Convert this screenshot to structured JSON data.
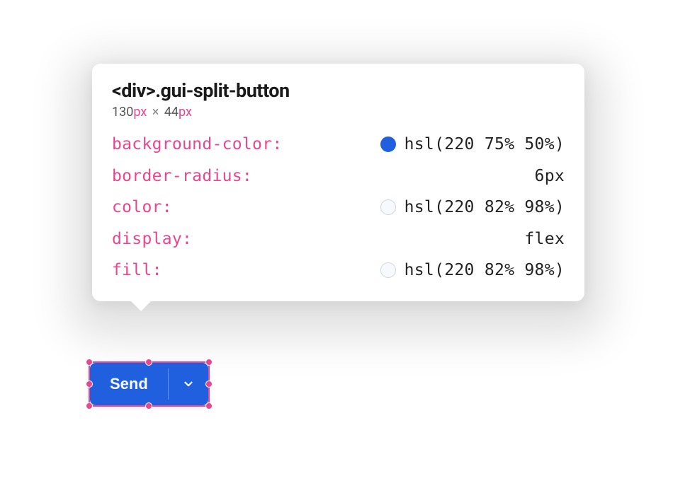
{
  "tooltip": {
    "selector": "<div>.gui-split-button",
    "dimensions": {
      "width": "130",
      "height": "44",
      "unit": "px",
      "separator": "×"
    },
    "properties": [
      {
        "name": "background-color",
        "value": "hsl(220 75% 50%)",
        "swatch": "#2060df"
      },
      {
        "name": "border-radius",
        "value": "6px",
        "swatch": null
      },
      {
        "name": "color",
        "value": "hsl(220 82% 98%)",
        "swatch": "#f6f9fe"
      },
      {
        "name": "display",
        "value": "flex",
        "swatch": null
      },
      {
        "name": "fill",
        "value": "hsl(220 82% 98%)",
        "swatch": "#f6f9fe"
      }
    ]
  },
  "button": {
    "label": "Send"
  },
  "colors": {
    "accent_pink": "#e8468e",
    "button_bg": "hsl(220 75% 50%)",
    "button_text": "hsl(220 82% 98%)"
  }
}
